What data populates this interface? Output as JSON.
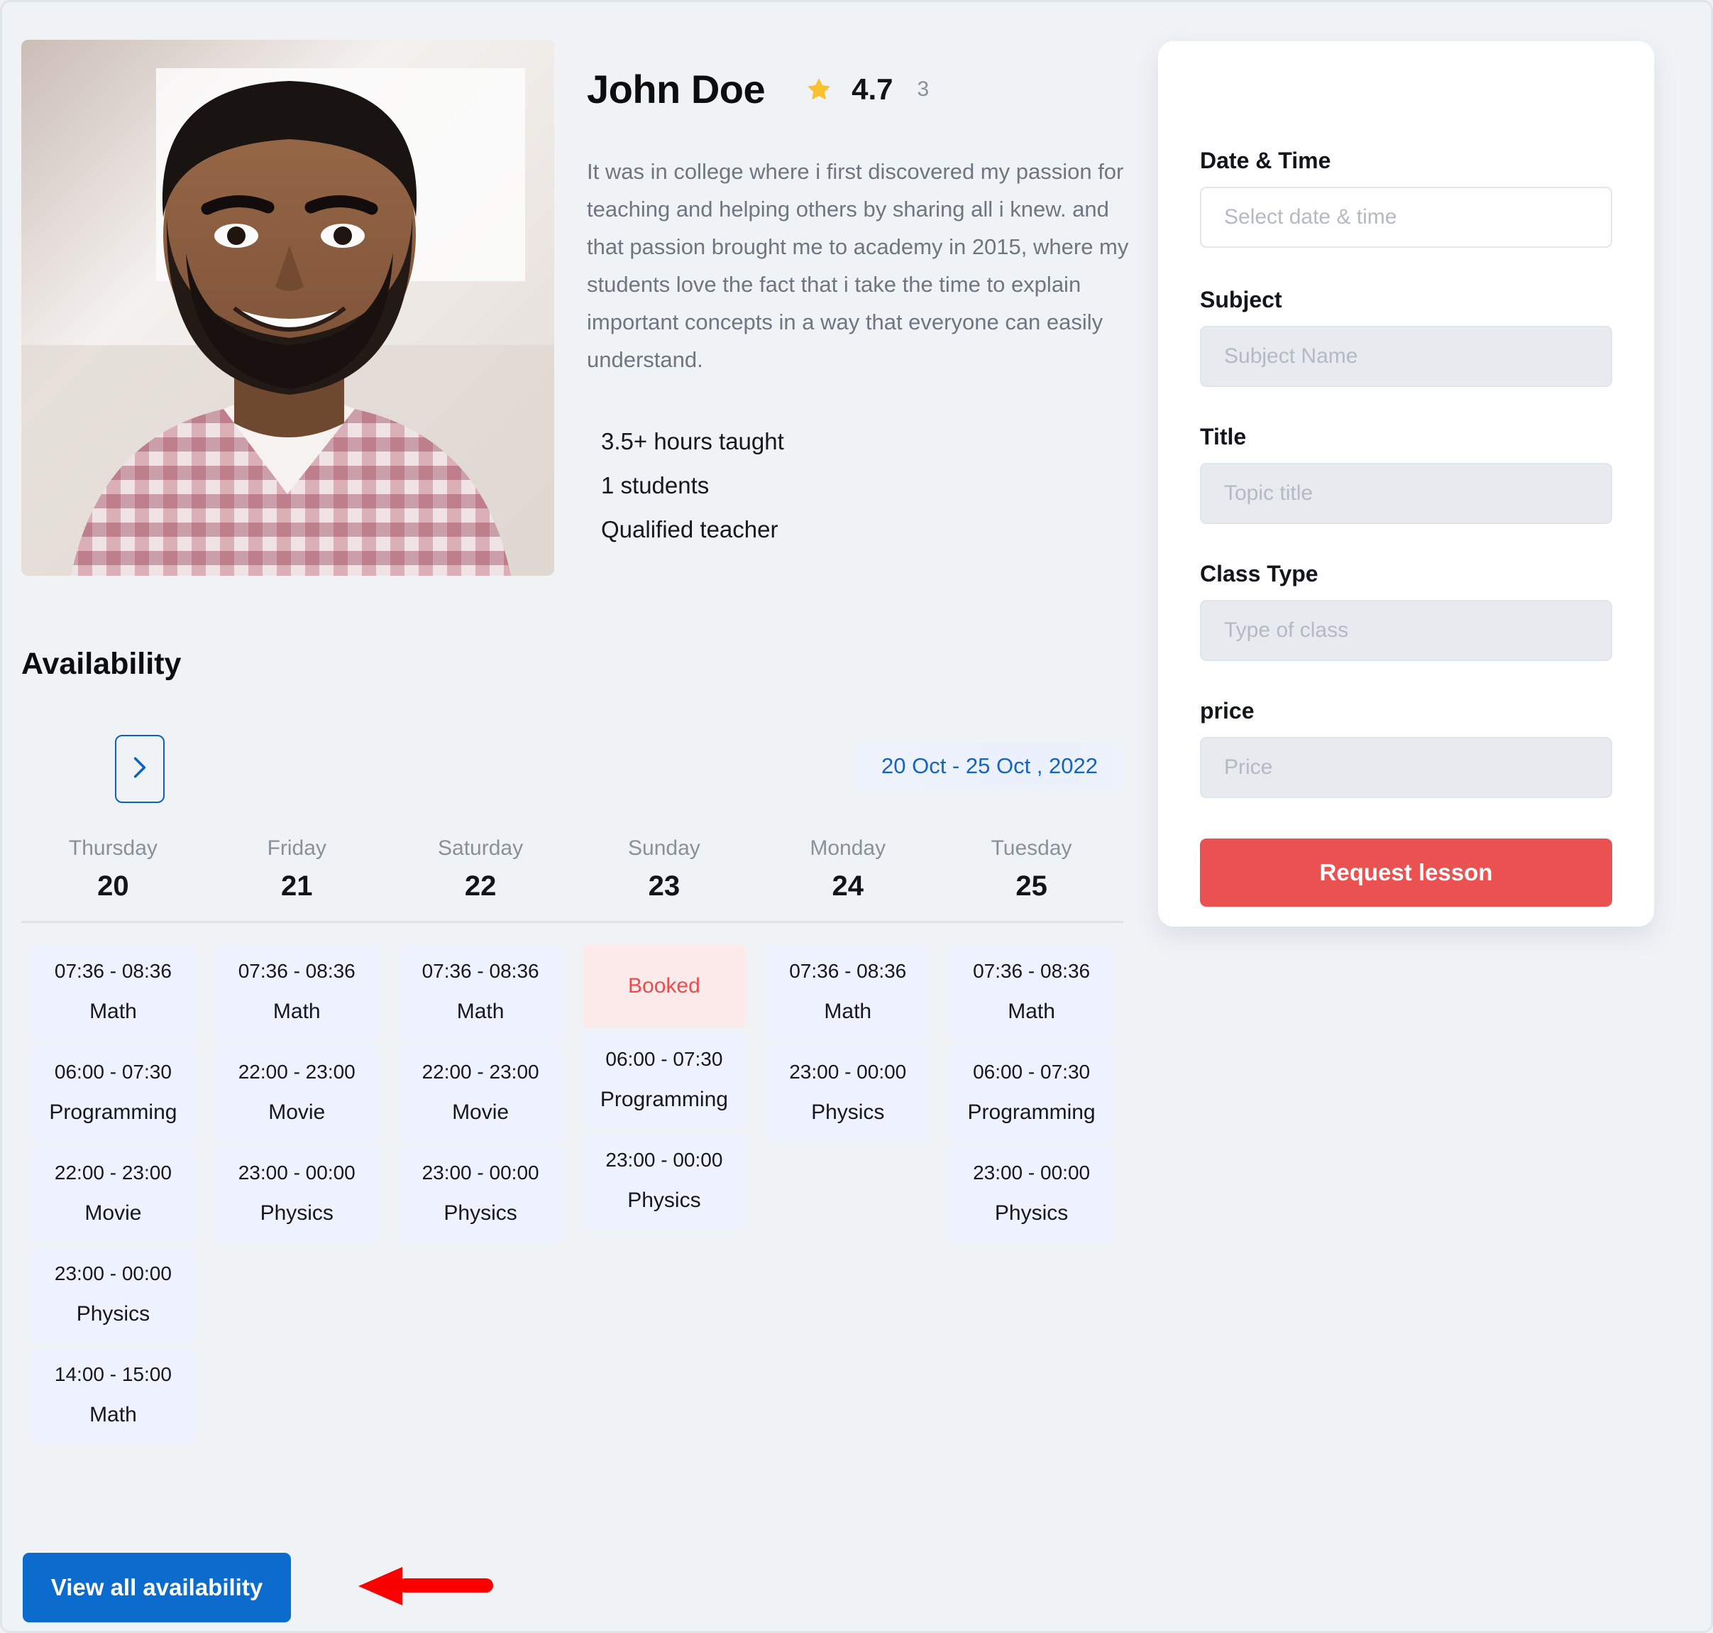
{
  "profile": {
    "name": "John Doe",
    "rating": "4.7",
    "review_count": "3",
    "star_icon": "star-icon",
    "bio": "It was in college where i first discovered my passion for teaching and helping others by sharing all i knew. and that passion brought me to academy in 2015, where my students love the fact that i take the time to explain important concepts in a way that everyone can easily understand.",
    "stats": [
      "3.5+ hours taught",
      "1 students",
      "Qualified teacher"
    ]
  },
  "availability": {
    "heading": "Availability",
    "next_week_icon": "chevron-right-icon",
    "date_range": "20 Oct - 25 Oct , 2022",
    "booked_label": "Booked",
    "view_all_label": "View all availability",
    "days": [
      {
        "name": "Thursday",
        "number": "20"
      },
      {
        "name": "Friday",
        "number": "21"
      },
      {
        "name": "Saturday",
        "number": "22"
      },
      {
        "name": "Sunday",
        "number": "23"
      },
      {
        "name": "Monday",
        "number": "24"
      },
      {
        "name": "Tuesday",
        "number": "25"
      }
    ],
    "columns": [
      [
        {
          "state": "open",
          "time": "07:36 - 08:36",
          "subject": "Math"
        },
        {
          "state": "open",
          "time": "06:00 - 07:30",
          "subject": "Programming"
        },
        {
          "state": "open",
          "time": "22:00 - 23:00",
          "subject": "Movie"
        },
        {
          "state": "open",
          "time": "23:00 - 00:00",
          "subject": "Physics"
        },
        {
          "state": "open",
          "time": "14:00 - 15:00",
          "subject": "Math"
        }
      ],
      [
        {
          "state": "open",
          "time": "07:36 - 08:36",
          "subject": "Math"
        },
        {
          "state": "open",
          "time": "22:00 - 23:00",
          "subject": "Movie"
        },
        {
          "state": "open",
          "time": "23:00 - 00:00",
          "subject": "Physics"
        }
      ],
      [
        {
          "state": "open",
          "time": "07:36 - 08:36",
          "subject": "Math"
        },
        {
          "state": "open",
          "time": "22:00 - 23:00",
          "subject": "Movie"
        },
        {
          "state": "open",
          "time": "23:00 - 00:00",
          "subject": "Physics"
        }
      ],
      [
        {
          "state": "booked",
          "time": "",
          "subject": ""
        },
        {
          "state": "open",
          "time": "06:00 - 07:30",
          "subject": "Programming"
        },
        {
          "state": "open",
          "time": "23:00 - 00:00",
          "subject": "Physics"
        }
      ],
      [
        {
          "state": "open",
          "time": "07:36 - 08:36",
          "subject": "Math"
        },
        {
          "state": "open",
          "time": "23:00 - 00:00",
          "subject": "Physics"
        }
      ],
      [
        {
          "state": "open",
          "time": "07:36 - 08:36",
          "subject": "Math"
        },
        {
          "state": "open",
          "time": "06:00 - 07:30",
          "subject": "Programming"
        },
        {
          "state": "open",
          "time": "23:00 - 00:00",
          "subject": "Physics"
        }
      ]
    ]
  },
  "booking": {
    "fields": [
      {
        "label": "Date & Time",
        "placeholder": "Select date & time",
        "value": "",
        "style": "outline"
      },
      {
        "label": "Subject",
        "placeholder": "Subject Name",
        "value": "",
        "style": "filled"
      },
      {
        "label": "Title",
        "placeholder": "Topic title",
        "value": "",
        "style": "filled"
      },
      {
        "label": "Class Type",
        "placeholder": "Type of class",
        "value": "",
        "style": "filled"
      },
      {
        "label": "price",
        "placeholder": "Price",
        "value": "",
        "style": "filled"
      }
    ],
    "submit_label": "Request lesson"
  },
  "colors": {
    "page_background": "#eff3f6",
    "primary_blue": "#0b6cce",
    "link_blue": "#1565c0",
    "submit_red": "#ea5252",
    "booked_red": "#ef4b4b",
    "slot_background": "#eef1fe",
    "booked_background": "#fdebeb",
    "annotation_red": "#fb0000",
    "star_yellow": "#fbc02d"
  }
}
